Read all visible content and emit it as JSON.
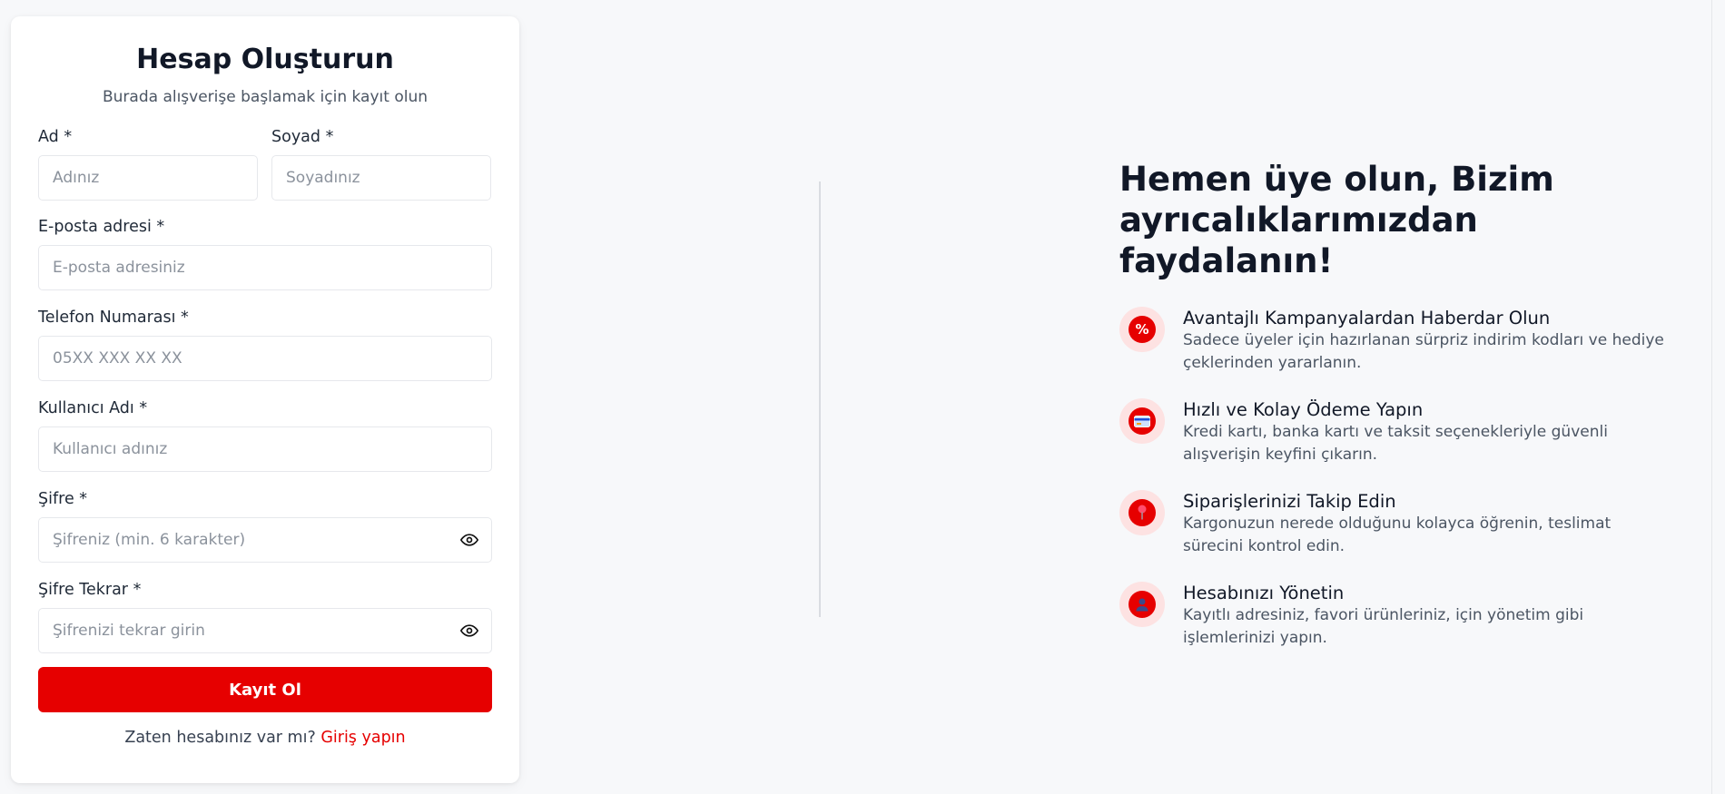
{
  "form": {
    "title": "Hesap Oluşturun",
    "subtitle": "Burada alışverişe başlamak için kayıt olun",
    "first_name": {
      "label": "Ad *",
      "placeholder": "Adınız",
      "value": ""
    },
    "last_name": {
      "label": "Soyad *",
      "placeholder": "Soyadınız",
      "value": ""
    },
    "email": {
      "label": "E-posta adresi *",
      "placeholder": "E-posta adresiniz",
      "value": ""
    },
    "phone": {
      "label": "Telefon Numarası *",
      "placeholder": "05XX XXX XX XX",
      "value": ""
    },
    "username": {
      "label": "Kullanıcı Adı *",
      "placeholder": "Kullanıcı adınız",
      "value": ""
    },
    "password": {
      "label": "Şifre *",
      "placeholder": "Şifreniz (min. 6 karakter)",
      "value": ""
    },
    "password_confirm": {
      "label": "Şifre Tekrar *",
      "placeholder": "Şifrenizi tekrar girin",
      "value": ""
    },
    "submit_label": "Kayıt Ol",
    "login_prompt": "Zaten hesabınız var mı?",
    "login_link": "Giriş yapın",
    "accent_color": "#e60000"
  },
  "promo": {
    "title": "Hemen üye olun, Bizim ayrıcalıklarımızdan faydalanın!",
    "features": [
      {
        "icon": "percent-icon",
        "title": "Avantajlı Kampanyalardan Haberdar Olun",
        "description": "Sadece üyeler için hazırlanan sürpriz indirim kodları ve hediye çeklerinden yararlanın."
      },
      {
        "icon": "credit-card-icon",
        "title": "Hızlı ve Kolay Ödeme Yapın",
        "description": "Kredi kartı, banka kartı ve taksit seçenekleriyle güvenli alışverişin keyfini çıkarın."
      },
      {
        "icon": "location-pin-icon",
        "title": "Siparişlerinizi Takip Edin",
        "description": "Kargonuzun nerede olduğunu kolayca öğrenin, teslimat sürecini kontrol edin."
      },
      {
        "icon": "user-icon",
        "title": "Hesabınızı Yönetin",
        "description": "Kayıtlı adresiniz, favori ürünleriniz, için yönetim gibi işlemlerinizi yapın."
      }
    ]
  }
}
